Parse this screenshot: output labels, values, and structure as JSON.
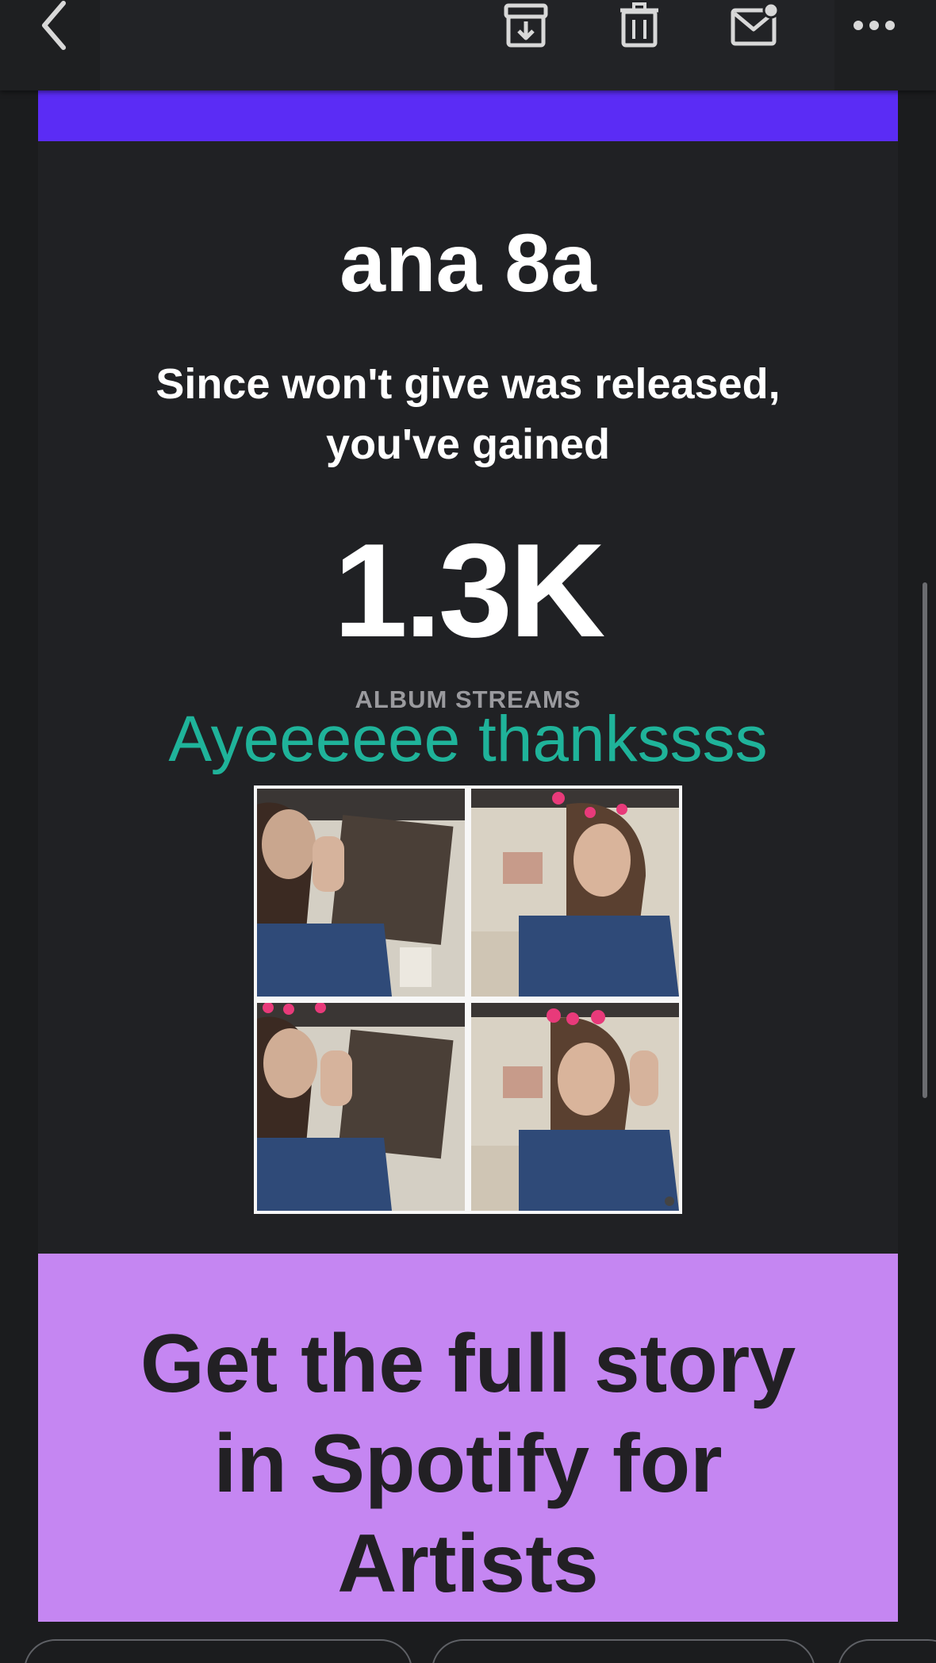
{
  "toolbar": {
    "back_icon": "chevron-left-icon",
    "archive_icon": "archive-icon",
    "delete_icon": "trash-icon",
    "mark_unread_icon": "mail-unread-icon",
    "more_icon": "more-horizontal-icon"
  },
  "email": {
    "accent_color": "#5b2cf5",
    "artist_name": "ana 8a",
    "subtitle_line1": "Since won't give was released,",
    "subtitle_line2": "you've gained",
    "metric_value": "1.3K",
    "metric_label": "ALBUM STREAMS",
    "caption": "Ayeeeeee thankssss",
    "caption_color": "#1fb39a",
    "promo": {
      "background": "#c586f2",
      "line1": "Get the full story",
      "line2": "in Spotify for",
      "line3": "Artists"
    }
  }
}
